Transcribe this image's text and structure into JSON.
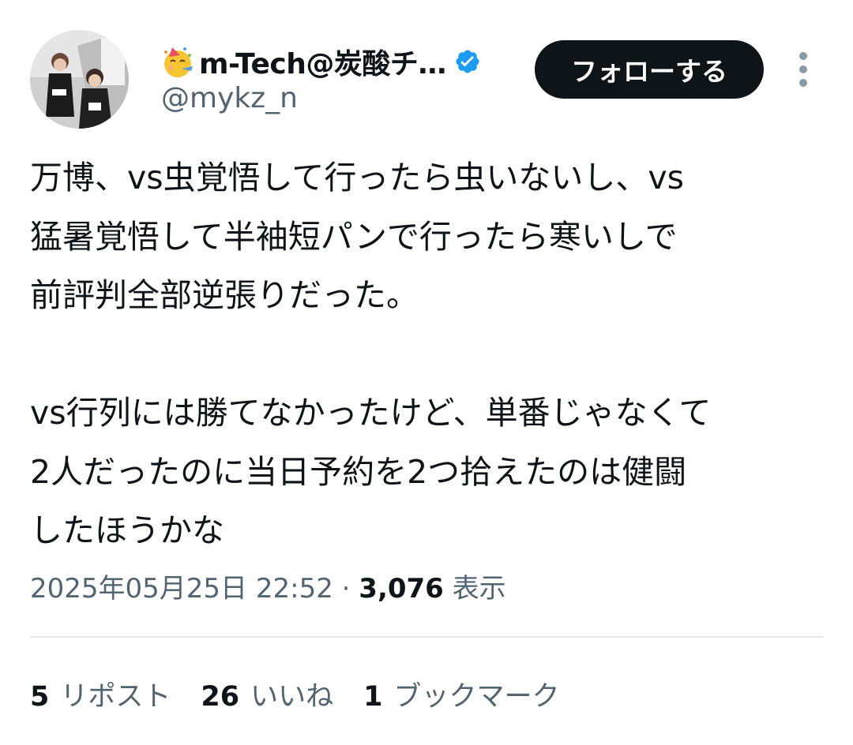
{
  "user": {
    "display_name": "m-Tech@炭酸チ…",
    "handle": "@mykz_n",
    "name_emoji": "partying-face-emoji",
    "verified_icon": "verified-badge-icon",
    "verified_color": "#1d9bf0"
  },
  "follow_button": {
    "label": "フォローする"
  },
  "more_icon": "more-vertical-icon",
  "tweet": {
    "text": "万博、vs虫覚悟して行ったら虫いないし、vs\n猛暑覚悟して半袖短パンで行ったら寒いしで\n前評判全部逆張りだった。\n\nvs行列には勝てなかったけど、単番じゃなくて\n2人だったのに当日予約を2つ拾えたのは健闘\nしたほうかな",
    "timestamp": "2025年05月25日 22:52",
    "separator": "·",
    "views_count": "3,076",
    "views_label": "表示"
  },
  "stats": [
    {
      "count": "5",
      "label": "リポスト"
    },
    {
      "count": "26",
      "label": "いいね"
    },
    {
      "count": "1",
      "label": "ブックマーク"
    }
  ],
  "colors": {
    "text_primary": "#0f1419",
    "text_secondary": "#536471",
    "button_bg": "#0f1419",
    "divider": "#e7e9ea"
  }
}
